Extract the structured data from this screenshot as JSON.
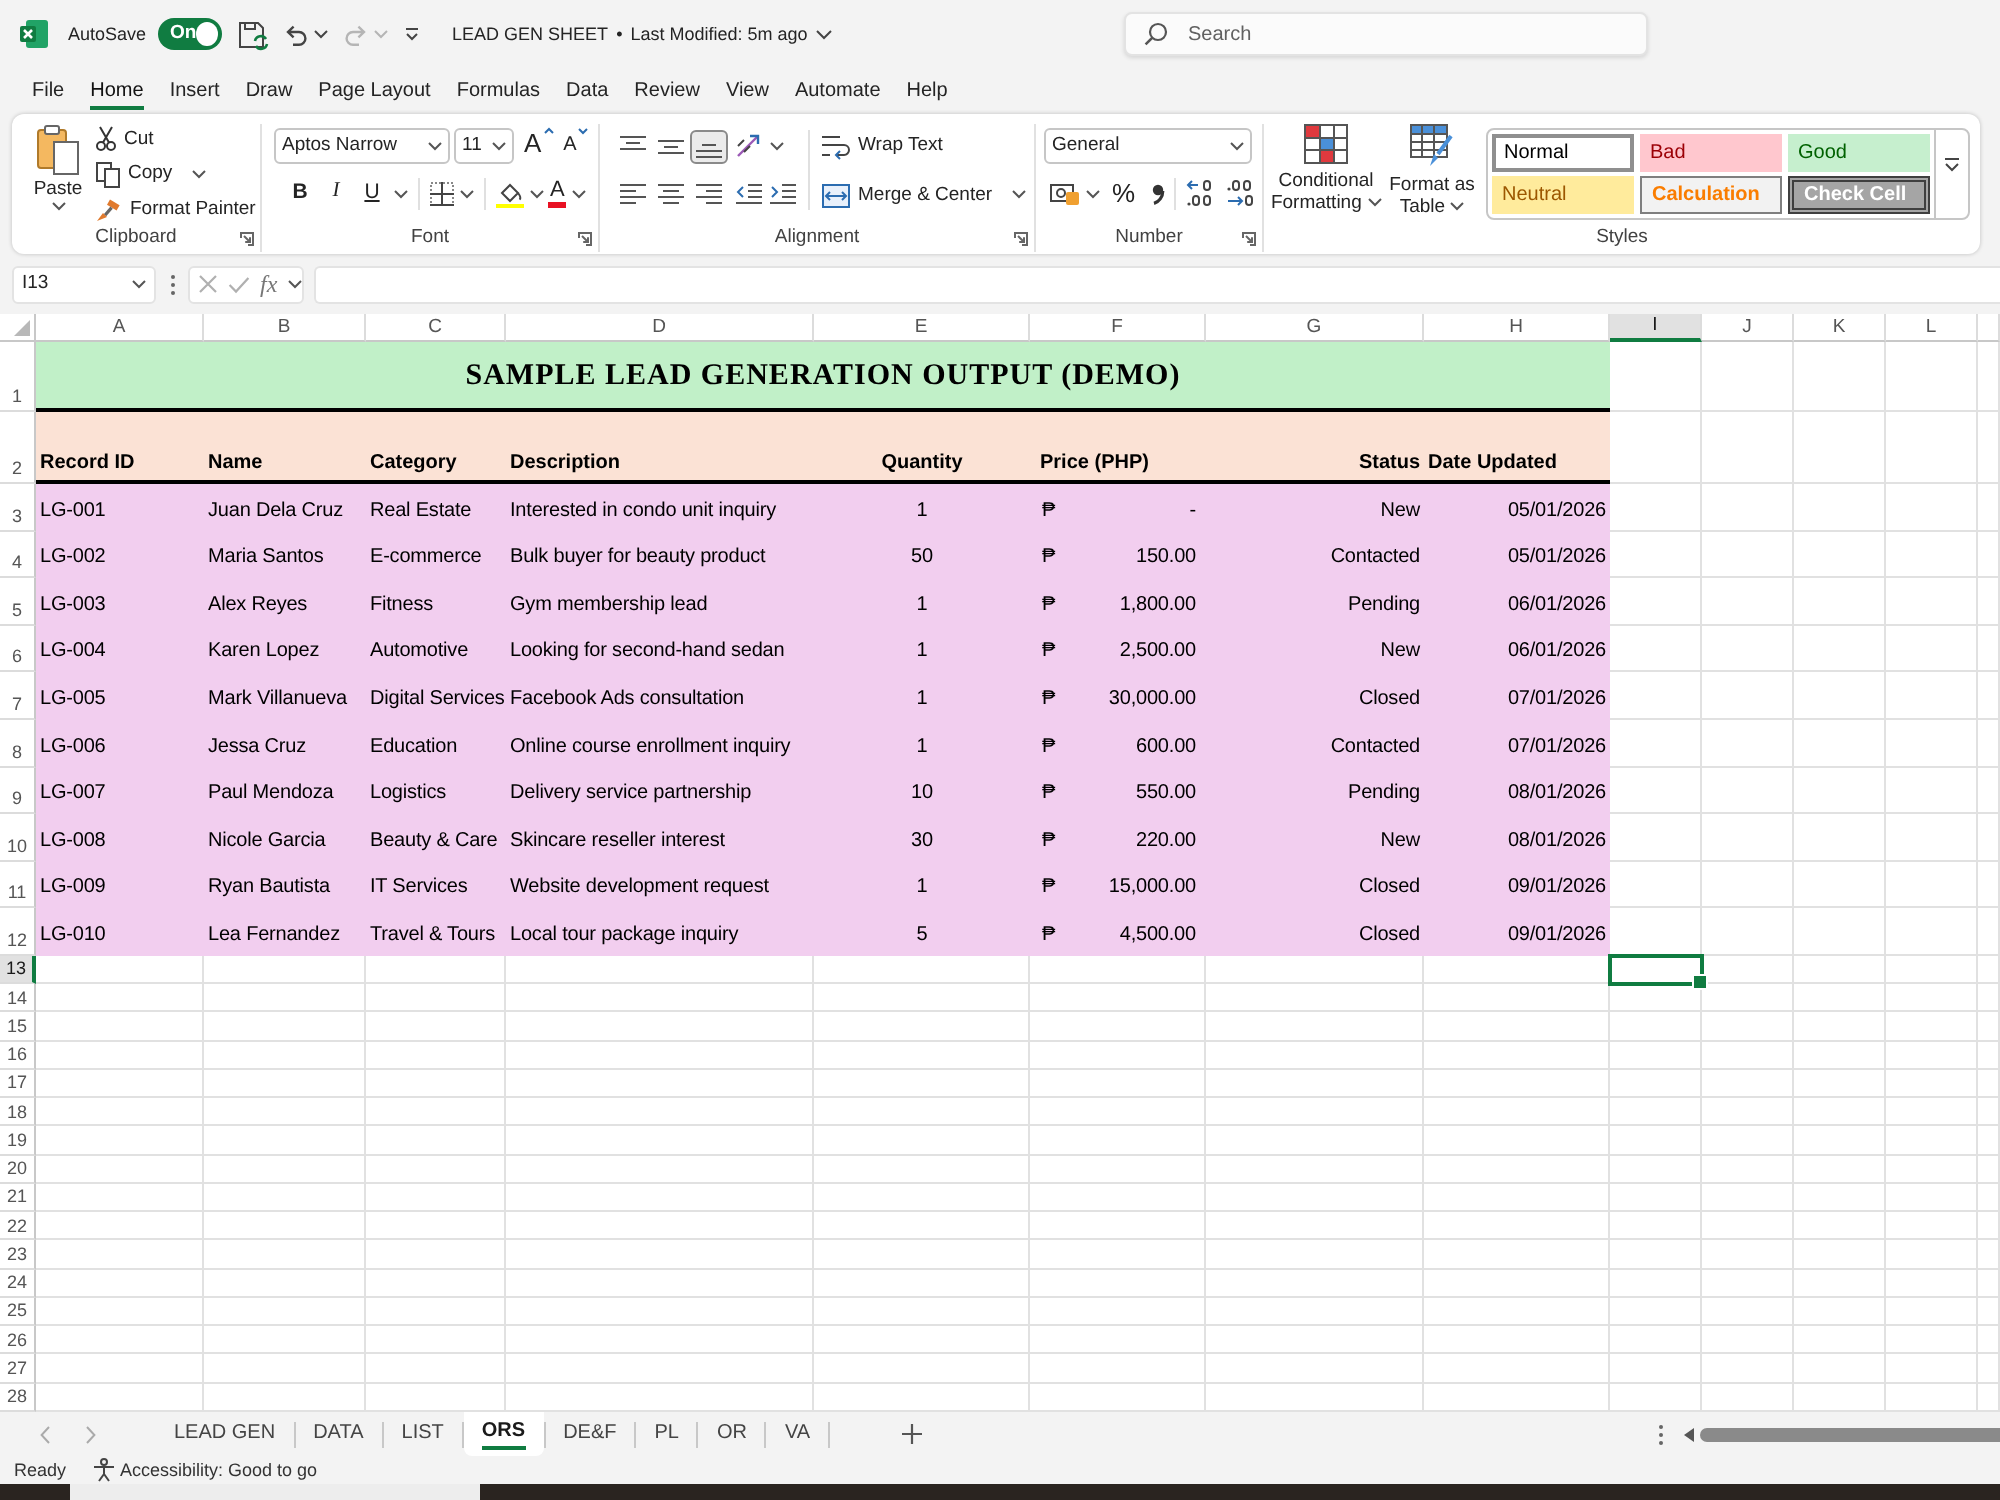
{
  "title_bar": {
    "autosave_label": "AutoSave",
    "autosave": {
      "label": "On",
      "on": true
    },
    "quick_access": [
      {
        "kind": "save"
      },
      {
        "kind": "undo",
        "disabled": false
      },
      {
        "kind": "redo",
        "disabled": true
      },
      {
        "kind": "customize"
      }
    ],
    "document_title": "LEAD GEN SHEET",
    "separator": "•",
    "last_modified": "Last Modified: 5m ago",
    "search": {
      "placeholder": "Search"
    }
  },
  "menu_tabs": [
    {
      "label": "File",
      "selected": false
    },
    {
      "label": "Home",
      "selected": true
    },
    {
      "label": "Insert",
      "selected": false
    },
    {
      "label": "Draw",
      "selected": false
    },
    {
      "label": "Page Layout",
      "selected": false
    },
    {
      "label": "Formulas",
      "selected": false
    },
    {
      "label": "Data",
      "selected": false
    },
    {
      "label": "Review",
      "selected": false
    },
    {
      "label": "View",
      "selected": false
    },
    {
      "label": "Automate",
      "selected": false
    },
    {
      "label": "Help",
      "selected": false
    }
  ],
  "ribbon": {
    "clipboard": {
      "paste": "Paste",
      "cut": "Cut",
      "copy": "Copy",
      "format_painter": "Format Painter",
      "label": "Clipboard"
    },
    "font": {
      "name": "Aptos Narrow",
      "size": "11",
      "grow": "A",
      "shrink": "A",
      "styles": [
        {
          "kind": "bold",
          "label": "B"
        },
        {
          "kind": "italic",
          "label": "I"
        },
        {
          "kind": "underline",
          "label": "U"
        }
      ],
      "font_color": "A",
      "label": "Font"
    },
    "alignment": {
      "vertical": [
        {
          "kind": "top",
          "selected": false
        },
        {
          "kind": "middle",
          "selected": false
        },
        {
          "kind": "bottom",
          "selected": true
        }
      ],
      "horizontal": [
        {
          "kind": "left",
          "selected": false
        },
        {
          "kind": "center",
          "selected": false
        },
        {
          "kind": "right",
          "selected": false
        }
      ],
      "wrap_text": "Wrap Text",
      "merge_center": "Merge & Center",
      "label": "Alignment"
    },
    "number": {
      "format": "General",
      "percent": "%",
      "label": "Number"
    },
    "styles": {
      "conditional_formatting": "Conditional Formatting",
      "format_as_table": "Format as Table",
      "cell_styles": [
        {
          "kind": "normal",
          "label": "Normal",
          "selected": true
        },
        {
          "kind": "bad",
          "label": "Bad",
          "selected": false
        },
        {
          "kind": "good",
          "label": "Good",
          "selected": false
        },
        {
          "kind": "neutral",
          "label": "Neutral",
          "selected": false
        },
        {
          "kind": "calculation",
          "label": "Calculation",
          "selected": false
        },
        {
          "kind": "check_cell",
          "label": "Check Cell",
          "selected": false
        }
      ],
      "label": "Styles"
    }
  },
  "formula_bar": {
    "name_box": "I13",
    "function_label": "fx"
  },
  "sheet": {
    "columns": [
      {
        "label": "A",
        "selected": false
      },
      {
        "label": "B",
        "selected": false
      },
      {
        "label": "C",
        "selected": false
      },
      {
        "label": "D",
        "selected": false
      },
      {
        "label": "E",
        "selected": false
      },
      {
        "label": "F",
        "selected": false
      },
      {
        "label": "G",
        "selected": false
      },
      {
        "label": "H",
        "selected": false
      },
      {
        "label": "I",
        "selected": true
      },
      {
        "label": "J",
        "selected": false
      },
      {
        "label": "K",
        "selected": false
      },
      {
        "label": "L",
        "selected": false
      }
    ],
    "rows": [
      {
        "label": "1",
        "selected": false
      },
      {
        "label": "2",
        "selected": false
      },
      {
        "label": "3",
        "selected": false
      },
      {
        "label": "4",
        "selected": false
      },
      {
        "label": "5",
        "selected": false
      },
      {
        "label": "6",
        "selected": false
      },
      {
        "label": "7",
        "selected": false
      },
      {
        "label": "8",
        "selected": false
      },
      {
        "label": "9",
        "selected": false
      },
      {
        "label": "10",
        "selected": false
      },
      {
        "label": "11",
        "selected": false
      },
      {
        "label": "12",
        "selected": false
      },
      {
        "label": "13",
        "selected": true
      },
      {
        "label": "14",
        "selected": false
      },
      {
        "label": "15",
        "selected": false
      },
      {
        "label": "16",
        "selected": false
      },
      {
        "label": "17",
        "selected": false
      },
      {
        "label": "18",
        "selected": false
      },
      {
        "label": "19",
        "selected": false
      },
      {
        "label": "20",
        "selected": false
      },
      {
        "label": "21",
        "selected": false
      },
      {
        "label": "22",
        "selected": false
      },
      {
        "label": "23",
        "selected": false
      },
      {
        "label": "24",
        "selected": false
      },
      {
        "label": "25",
        "selected": false
      },
      {
        "label": "26",
        "selected": false
      },
      {
        "label": "27",
        "selected": false
      },
      {
        "label": "28",
        "selected": false
      }
    ],
    "title": "SAMPLE LEAD GENERATION OUTPUT (DEMO)",
    "headers": [
      "Record ID",
      "Name",
      "Category",
      "Description",
      "Quantity",
      "Price (PHP)",
      "Status",
      "Date Updated"
    ],
    "records": [
      {
        "record_id": "LG-001",
        "name": "Juan Dela Cruz",
        "category": "Real Estate",
        "description": "Interested in condo unit inquiry",
        "quantity": "1",
        "currency": "₱",
        "price": "-",
        "status": "New",
        "date_updated": "05/01/2026"
      },
      {
        "record_id": "LG-002",
        "name": "Maria Santos",
        "category": "E-commerce",
        "description": "Bulk buyer for beauty product",
        "quantity": "50",
        "currency": "₱",
        "price": "150.00",
        "status": "Contacted",
        "date_updated": "05/01/2026"
      },
      {
        "record_id": "LG-003",
        "name": "Alex Reyes",
        "category": "Fitness",
        "description": "Gym membership lead",
        "quantity": "1",
        "currency": "₱",
        "price": "1,800.00",
        "status": "Pending",
        "date_updated": "06/01/2026"
      },
      {
        "record_id": "LG-004",
        "name": "Karen Lopez",
        "category": "Automotive",
        "description": "Looking for second-hand sedan",
        "quantity": "1",
        "currency": "₱",
        "price": "2,500.00",
        "status": "New",
        "date_updated": "06/01/2026"
      },
      {
        "record_id": "LG-005",
        "name": "Mark Villanueva",
        "category": "Digital Services",
        "description": "Facebook Ads consultation",
        "quantity": "1",
        "currency": "₱",
        "price": "30,000.00",
        "status": "Closed",
        "date_updated": "07/01/2026"
      },
      {
        "record_id": "LG-006",
        "name": "Jessa Cruz",
        "category": "Education",
        "description": "Online course enrollment inquiry",
        "quantity": "1",
        "currency": "₱",
        "price": "600.00",
        "status": "Contacted",
        "date_updated": "07/01/2026"
      },
      {
        "record_id": "LG-007",
        "name": "Paul Mendoza",
        "category": "Logistics",
        "description": "Delivery service partnership",
        "quantity": "10",
        "currency": "₱",
        "price": "550.00",
        "status": "Pending",
        "date_updated": "08/01/2026"
      },
      {
        "record_id": "LG-008",
        "name": "Nicole Garcia",
        "category": "Beauty & Care",
        "description": "Skincare reseller interest",
        "quantity": "30",
        "currency": "₱",
        "price": "220.00",
        "status": "New",
        "date_updated": "08/01/2026"
      },
      {
        "record_id": "LG-009",
        "name": "Ryan Bautista",
        "category": "IT Services",
        "description": "Website development request",
        "quantity": "1",
        "currency": "₱",
        "price": "15,000.00",
        "status": "Closed",
        "date_updated": "09/01/2026"
      },
      {
        "record_id": "LG-010",
        "name": "Lea Fernandez",
        "category": "Travel & Tours",
        "description": "Local tour package inquiry",
        "quantity": "5",
        "currency": "₱",
        "price": "4,500.00",
        "status": "Closed",
        "date_updated": "09/01/2026"
      }
    ]
  },
  "sheet_tabs": [
    {
      "label": "LEAD GEN",
      "selected": false
    },
    {
      "label": "DATA",
      "selected": false
    },
    {
      "label": "LIST",
      "selected": false
    },
    {
      "label": "ORS",
      "selected": true
    },
    {
      "label": "DE&F",
      "selected": false
    },
    {
      "label": "PL",
      "selected": false
    },
    {
      "label": "OR",
      "selected": false
    },
    {
      "label": "VA",
      "selected": false
    }
  ],
  "status_bar": {
    "mode": "Ready",
    "accessibility": "Accessibility: Good to go"
  }
}
